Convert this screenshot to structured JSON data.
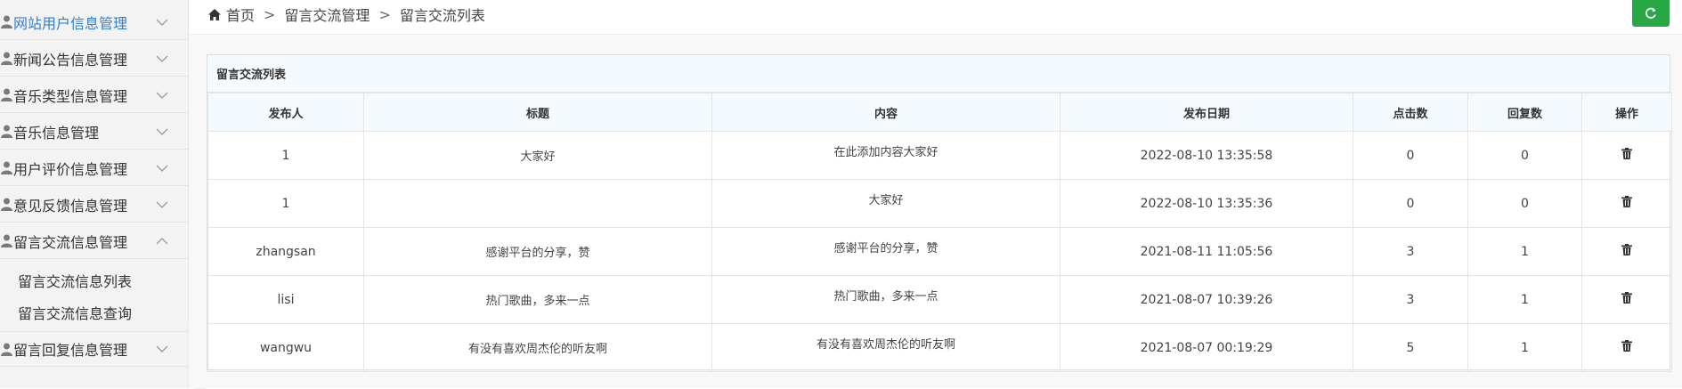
{
  "sidebar": {
    "items": [
      {
        "label": "网站用户信息管理",
        "active": true,
        "expanded": false
      },
      {
        "label": "新闻公告信息管理",
        "active": false,
        "expanded": false
      },
      {
        "label": "音乐类型信息管理",
        "active": false,
        "expanded": false
      },
      {
        "label": "音乐信息管理",
        "active": false,
        "expanded": false
      },
      {
        "label": "用户评价信息管理",
        "active": false,
        "expanded": false
      },
      {
        "label": "意见反馈信息管理",
        "active": false,
        "expanded": false
      },
      {
        "label": "留言交流信息管理",
        "active": false,
        "expanded": true
      },
      {
        "label": "留言回复信息管理",
        "active": false,
        "expanded": false
      }
    ],
    "submenu": [
      {
        "label": "留言交流信息列表"
      },
      {
        "label": "留言交流信息查询"
      }
    ]
  },
  "breadcrumb": {
    "home_icon": "home-icon",
    "home": "首页",
    "sep1": ">",
    "section": "留言交流管理",
    "sep2": ">",
    "page": "留言交流列表"
  },
  "refresh": {
    "icon": "refresh-icon",
    "color": "#28a745"
  },
  "panel": {
    "title": "留言交流列表",
    "columns": [
      "发布人",
      "标题",
      "内容",
      "发布日期",
      "点击数",
      "回复数",
      "操作"
    ],
    "rows": [
      {
        "author": "1",
        "title": "大家好",
        "content": "在此添加内容大家好",
        "date": "2022-08-10 13:35:58",
        "clicks": "0",
        "replies": "0",
        "action_icon": "trash-icon"
      },
      {
        "author": "1",
        "title": "",
        "content": "大家好",
        "date": "2022-08-10 13:35:36",
        "clicks": "0",
        "replies": "0",
        "action_icon": "trash-icon"
      },
      {
        "author": "zhangsan",
        "title": "感谢平台的分享，赞",
        "content": "感谢平台的分享，赞",
        "date": "2021-08-11 11:05:56",
        "clicks": "3",
        "replies": "1",
        "action_icon": "trash-icon"
      },
      {
        "author": "lisi",
        "title": "热门歌曲，多来一点",
        "content": "热门歌曲，多来一点",
        "date": "2021-08-07 10:39:26",
        "clicks": "3",
        "replies": "1",
        "action_icon": "trash-icon"
      },
      {
        "author": "wangwu",
        "title": "有没有喜欢周杰伦的听友啊",
        "content": "有没有喜欢周杰伦的听友啊",
        "date": "2021-08-07 00:19:29",
        "clicks": "5",
        "replies": "1",
        "action_icon": "trash-icon"
      }
    ]
  },
  "colors": {
    "active": "#2f7fd1",
    "sidebar_bg": "#f3f3f3",
    "header_bg": "#f5faff"
  }
}
